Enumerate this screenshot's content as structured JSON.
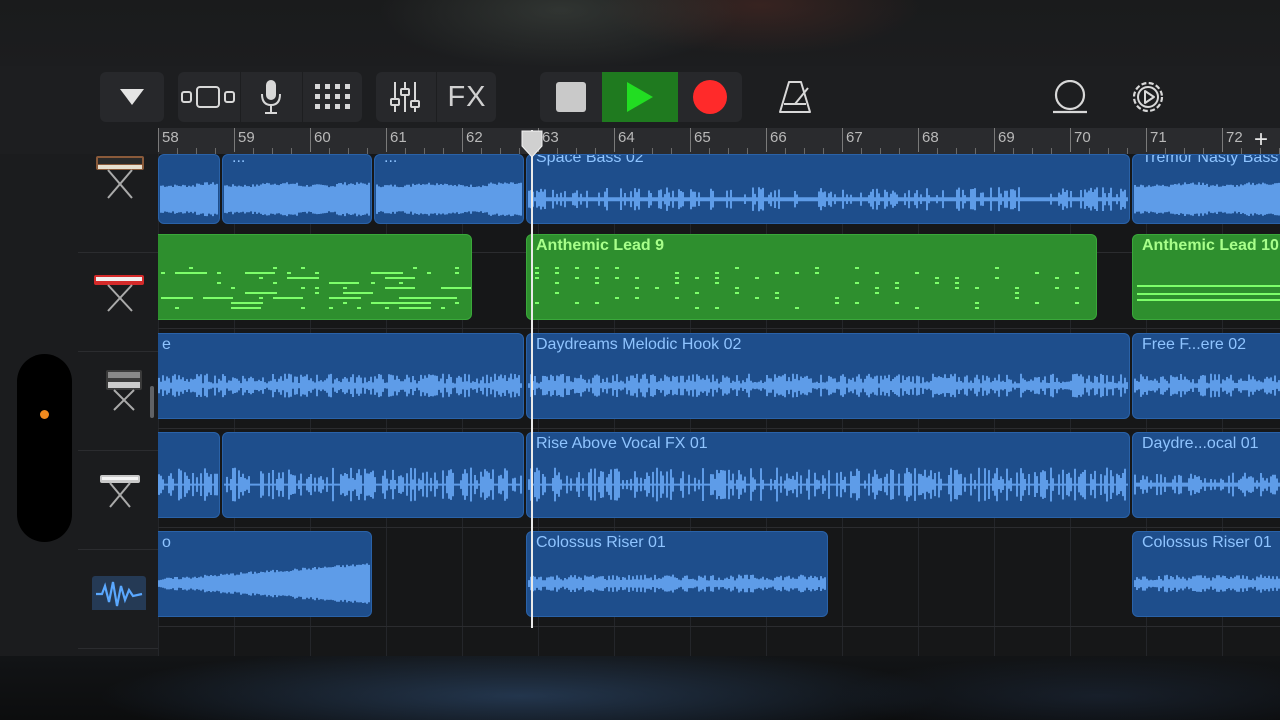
{
  "toolbar": {
    "view_menu_icon": "triangle-down-icon",
    "tracks_view_icon": "tracks-view-icon",
    "microphone_icon": "microphone-icon",
    "grid_icon": "grid-icon",
    "mixer_icon": "mixer-icon",
    "fx_label": "FX",
    "stop_icon": "stop-icon",
    "play_icon": "play-icon",
    "record_icon": "record-icon",
    "metronome_icon": "metronome-icon",
    "loop_icon": "loop-icon",
    "settings_icon": "gear-icon",
    "colors": {
      "play_active": "#1f7a1f",
      "play_arrow": "#22dd22",
      "record": "#ff2a2a"
    }
  },
  "ruler": {
    "bars": [
      "58",
      "59",
      "60",
      "61",
      "62",
      "63",
      "64",
      "65",
      "66",
      "67",
      "68",
      "69",
      "70",
      "71",
      "72"
    ],
    "add_icon": "plus-icon"
  },
  "tracks": [
    {
      "instrument_icon": "synth-keyboard-icon",
      "regions": [
        {
          "type": "audio",
          "label": "..."
        },
        {
          "type": "audio",
          "label": "..."
        },
        {
          "type": "audio",
          "label": "Space Bass 02"
        },
        {
          "type": "audio",
          "label": "Tremor Nasty Bass"
        }
      ]
    },
    {
      "instrument_icon": "red-keyboard-icon",
      "regions": [
        {
          "type": "midi",
          "label": ""
        },
        {
          "type": "midi",
          "label": "Anthemic Lead 9"
        },
        {
          "type": "midi",
          "label": "Anthemic Lead 10"
        }
      ]
    },
    {
      "instrument_icon": "keyboard-stand-icon",
      "regions": [
        {
          "type": "audio",
          "label": "e"
        },
        {
          "type": "audio",
          "label": "Daydreams Melodic Hook 02"
        },
        {
          "type": "audio",
          "label": "Free F...ere 02"
        }
      ]
    },
    {
      "instrument_icon": "piano-keyboard-icon",
      "regions": [
        {
          "type": "audio",
          "label": ""
        },
        {
          "type": "audio",
          "label": ""
        },
        {
          "type": "audio",
          "label": "Rise Above Vocal FX 01"
        },
        {
          "type": "audio",
          "label": "Daydre...ocal 01"
        }
      ]
    },
    {
      "instrument_icon": "waveform-icon",
      "regions": [
        {
          "type": "audio",
          "label": "o"
        },
        {
          "type": "audio",
          "label": "Colossus Riser 01"
        },
        {
          "type": "audio",
          "label": "Colossus Riser 01"
        }
      ]
    }
  ]
}
